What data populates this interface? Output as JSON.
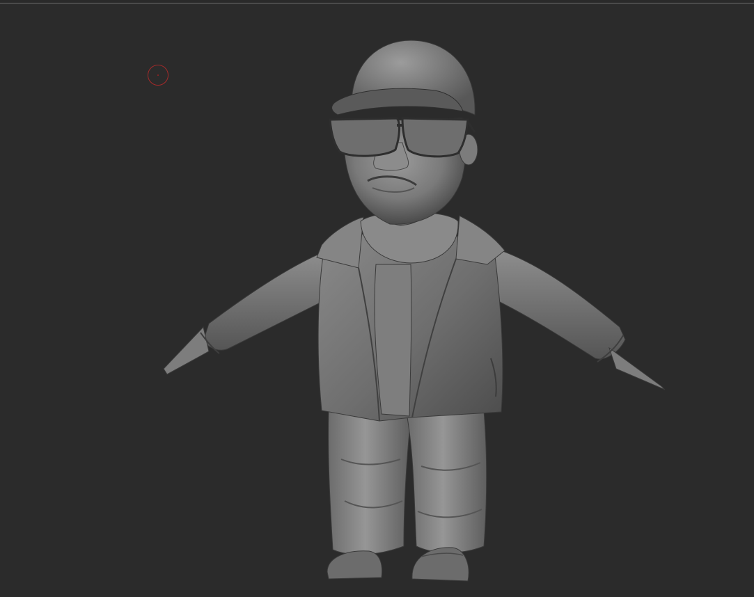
{
  "viewport": {
    "background_color": "#2b2b2b",
    "border_color": "#6f6f6f"
  },
  "brush_cursor": {
    "icon": "circle-brush-cursor-icon",
    "color": "#a42a2a"
  },
  "model": {
    "icon": "clay-sculpt-figure",
    "base_color": "#7a7a7a",
    "highlight_color": "#a5a5a5",
    "shadow_color": "#3c3c3c"
  }
}
